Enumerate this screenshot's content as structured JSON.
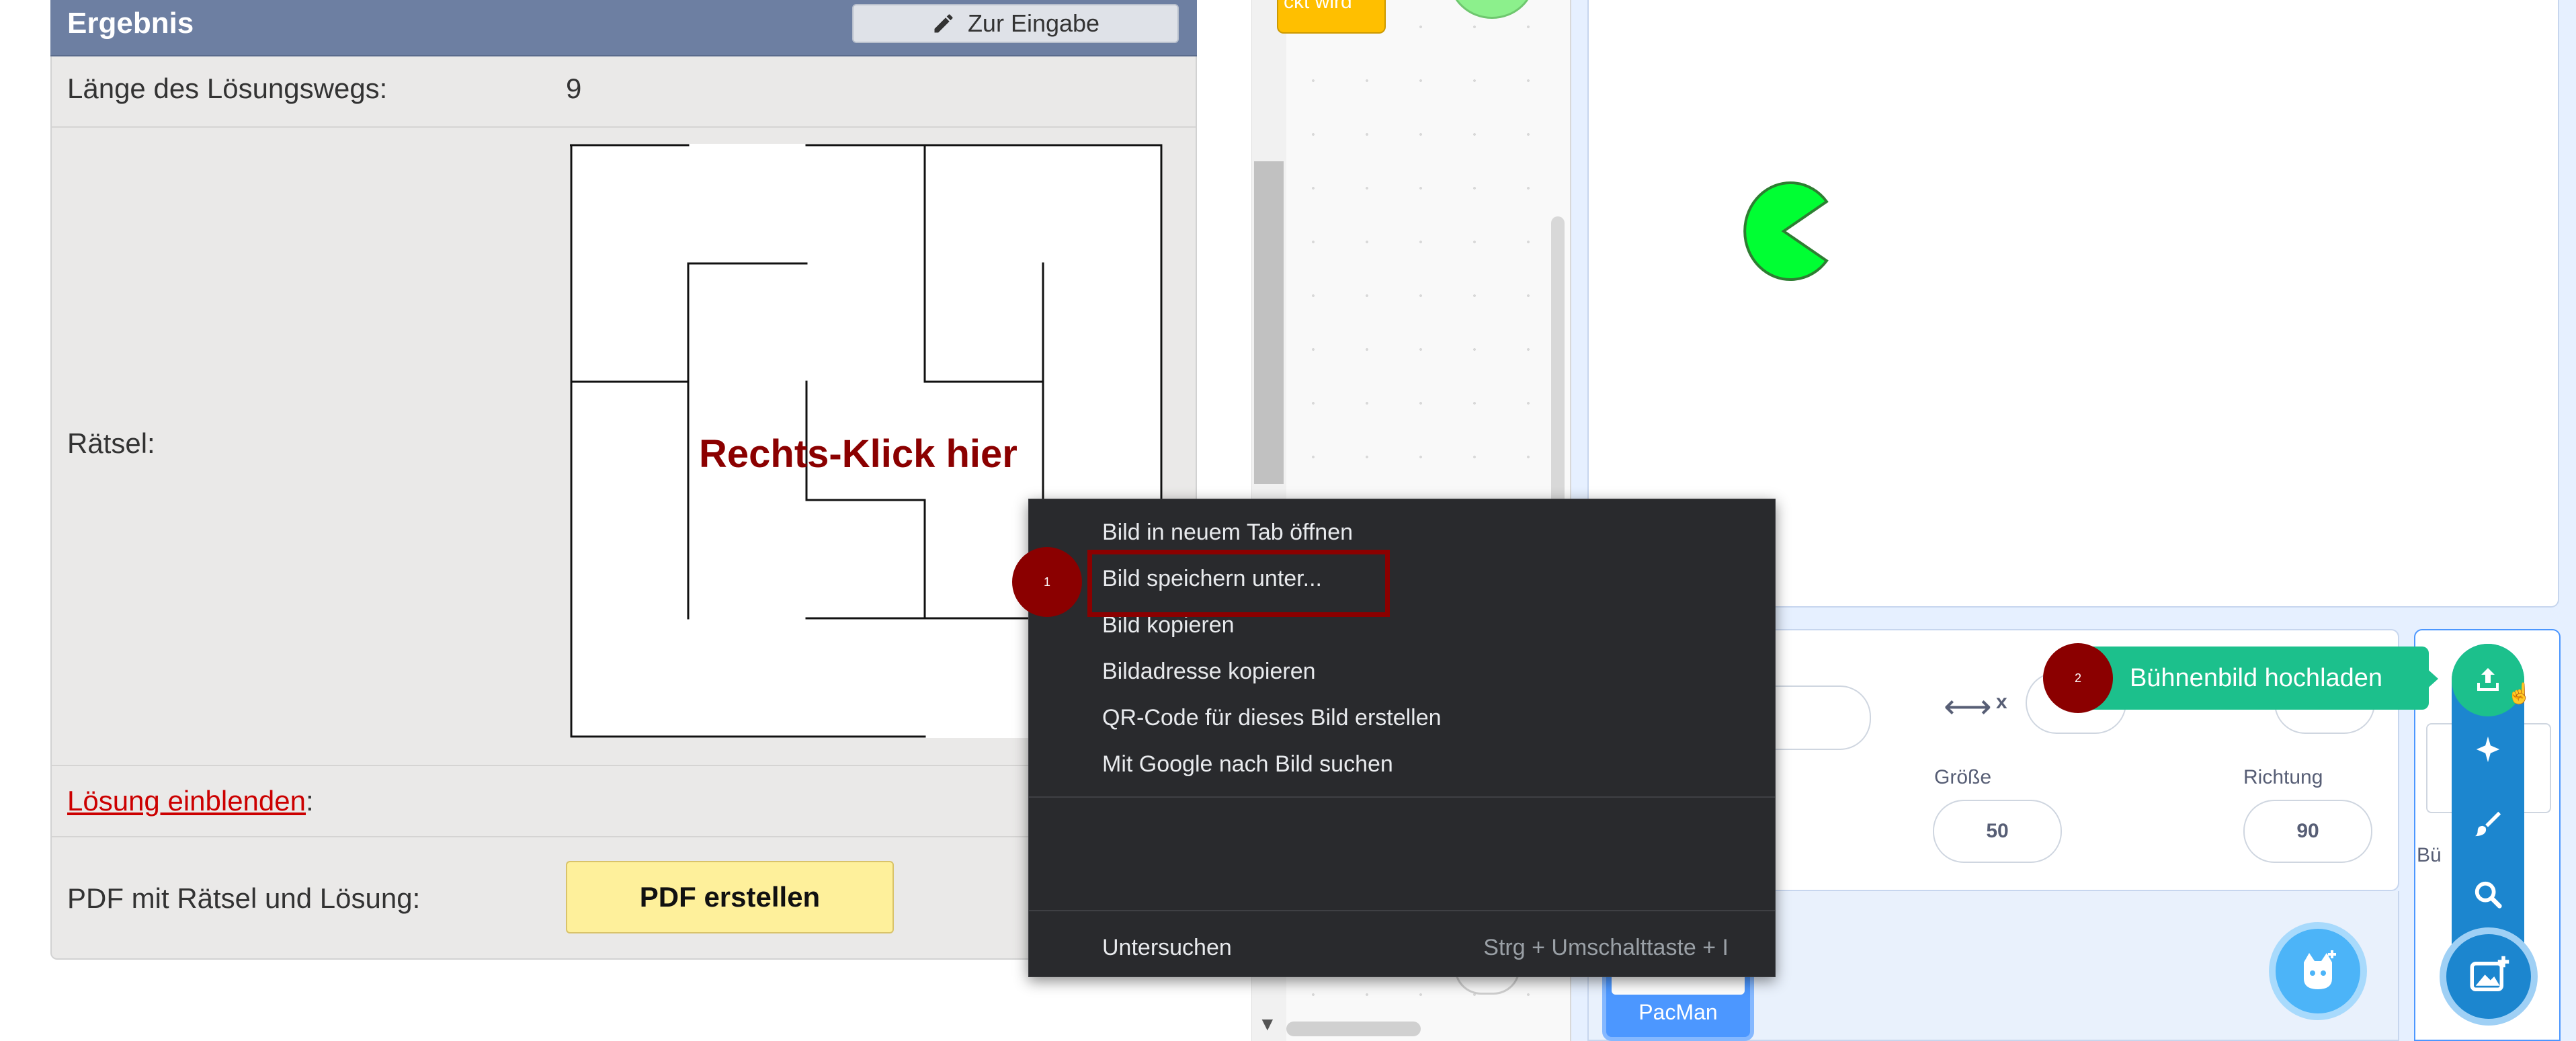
{
  "left_panel": {
    "title": "Ergebnis",
    "back_button": "Zur Eingabe",
    "path_length_label": "Länge des Lösungswegs:",
    "path_length_value": "9",
    "puzzle_label": "Rätsel:",
    "maze_overlay_text": "Rechts-Klick hier",
    "solution_link": "Lösung einblenden",
    "solution_suffix": ":",
    "pdf_label": "PDF mit Rätsel und Lösung:",
    "pdf_button": "PDF erstellen"
  },
  "context_menu": {
    "items": [
      "Bild in neuem Tab öffnen",
      "Bild speichern unter...",
      "Bild kopieren",
      "Bildadresse kopieren",
      "QR-Code für dieses Bild erstellen",
      "Mit Google nach Bild suchen"
    ],
    "inspect": "Untersuchen",
    "inspect_shortcut": "Strg + Umschalttaste + I",
    "theme": "#292a2d"
  },
  "step_markers": {
    "step1": "1",
    "step2": "2"
  },
  "scratch": {
    "code_block_fragment": "ckt wird",
    "sprite_info": {
      "x_label": "x",
      "size_label": "Größe",
      "size_value": "50",
      "direction_label": "Richtung",
      "direction_value": "90"
    },
    "sprite_name": "PacMan",
    "stage_label_fragment": "Bü         der",
    "tooltip": "Bühnenbild hochladen",
    "icons": [
      "upload-icon",
      "surprise-icon",
      "paint-icon",
      "search-icon",
      "choose-sprite-icon",
      "choose-backdrop-icon"
    ],
    "colors": {
      "accent": "#4c97ff",
      "tooltip": "#1cc08c",
      "sprite_fill": "#00ff33"
    }
  },
  "colors": {
    "header": "#6d7fa2",
    "annotation": "#8b0000",
    "link": "#cc0000",
    "pdf_button": "#fef09b"
  }
}
